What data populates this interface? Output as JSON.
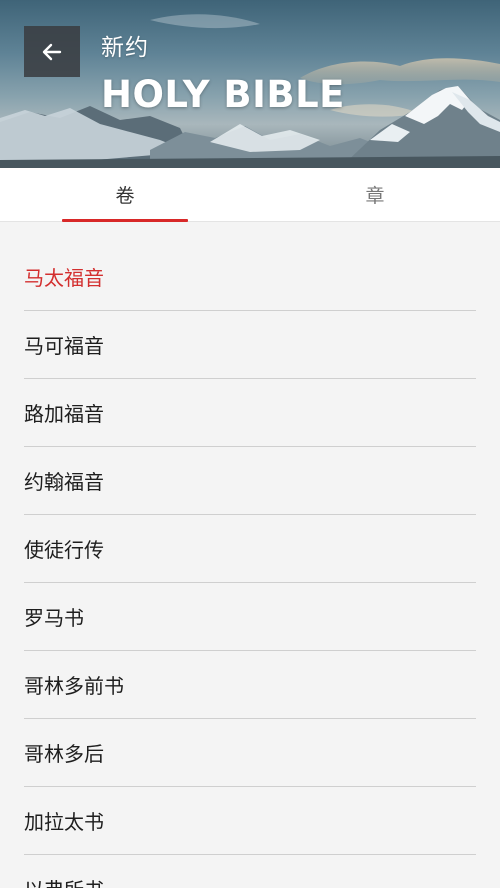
{
  "header": {
    "subtitle": "新约",
    "title": "HOLY BIBLE",
    "back_icon": "arrow-left-icon"
  },
  "tabs": [
    {
      "label": "卷",
      "active": true
    },
    {
      "label": "章",
      "active": false
    }
  ],
  "colors": {
    "accent": "#d82828",
    "selected_text": "#d32f2f"
  },
  "books": [
    {
      "label": "马太福音",
      "selected": true
    },
    {
      "label": "马可福音",
      "selected": false
    },
    {
      "label": "路加福音",
      "selected": false
    },
    {
      "label": "约翰福音",
      "selected": false
    },
    {
      "label": "使徒行传",
      "selected": false
    },
    {
      "label": "罗马书",
      "selected": false
    },
    {
      "label": "哥林多前书",
      "selected": false
    },
    {
      "label": "哥林多后",
      "selected": false
    },
    {
      "label": "加拉太书",
      "selected": false
    },
    {
      "label": "以弗所书",
      "selected": false
    }
  ]
}
